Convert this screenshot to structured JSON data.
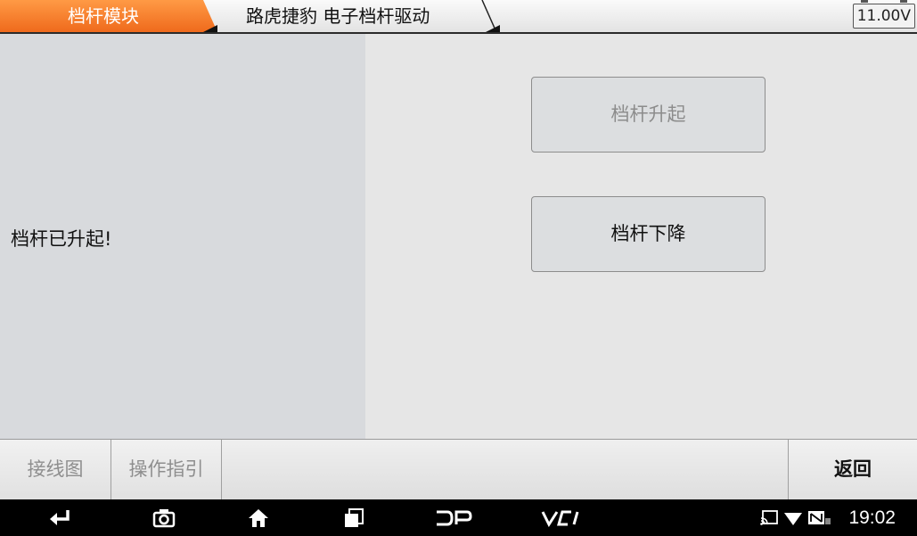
{
  "header": {
    "crumbs": [
      {
        "label": "档杆模块"
      },
      {
        "label": "路虎捷豹 电子档杆驱动"
      }
    ],
    "voltage": "11.00V"
  },
  "main": {
    "status_text": "档杆已升起!",
    "buttons": {
      "raise_label": "档杆升起",
      "lower_label": "档杆下降"
    }
  },
  "toolbar": {
    "wiring_label": "接线图",
    "guide_label": "操作指引",
    "back_label": "返回"
  },
  "navbar": {
    "icons": [
      "back-icon",
      "camera-icon",
      "home-icon",
      "recent-apps-icon",
      "dp-icon",
      "vci-icon"
    ],
    "dp_label": "DP",
    "vci_label": "VCI",
    "status_icons": [
      "cast-icon",
      "wifi-icon",
      "no-signal-icon"
    ],
    "clock": "19:02"
  },
  "colors": {
    "accent": "#f26b1f",
    "header_border": "#2b2b2b",
    "left_panel": "#d8dadd",
    "right_panel": "#e6e6e6"
  }
}
